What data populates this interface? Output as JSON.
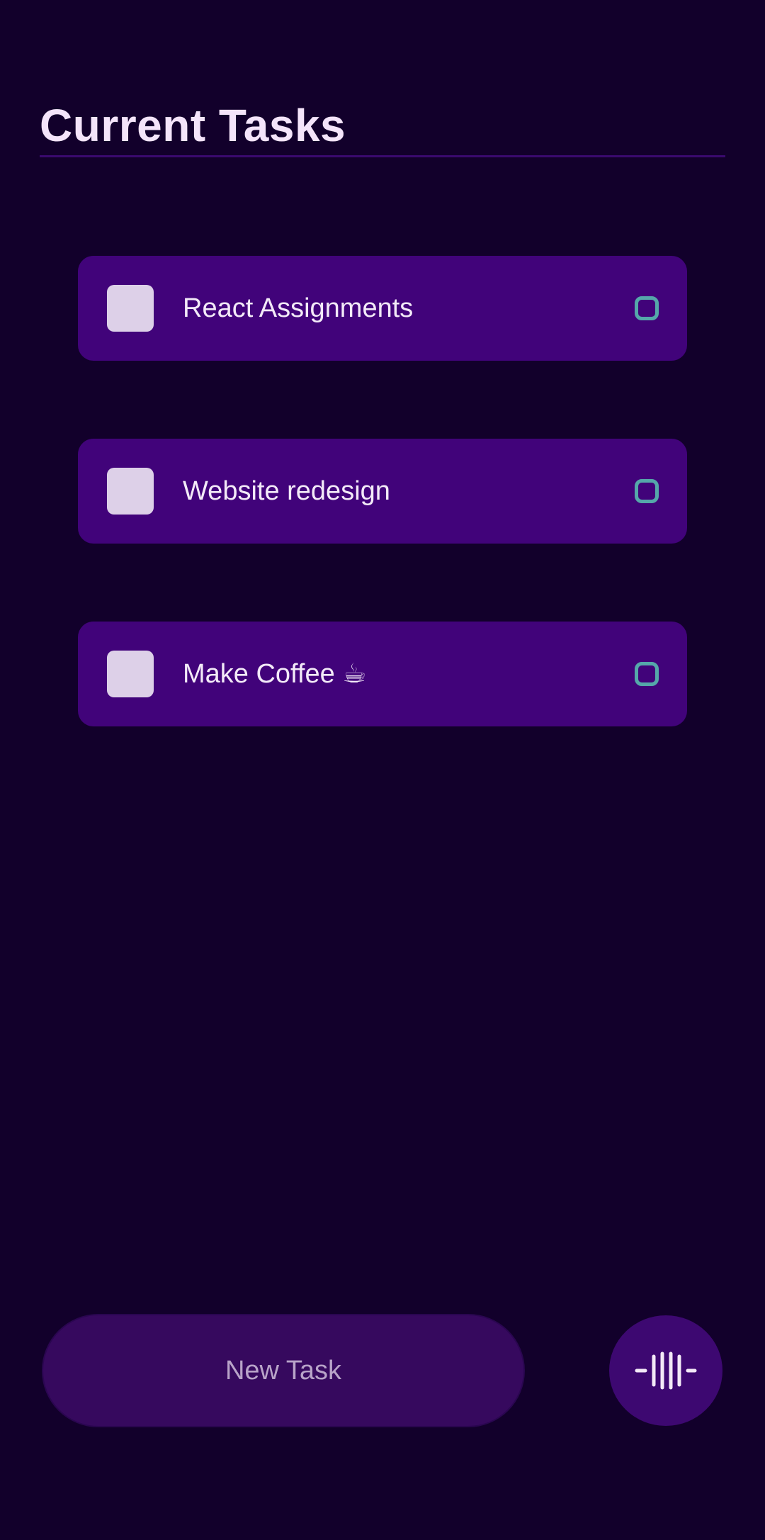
{
  "header": {
    "title": "Current Tasks"
  },
  "tasks": [
    {
      "label": "React Assignments",
      "checked": false
    },
    {
      "label": "Website redesign",
      "checked": false
    },
    {
      "label": "Make Coffee ☕",
      "checked": false
    }
  ],
  "input": {
    "placeholder": "New Task"
  },
  "voice_button": {
    "icon": "voice-waveform-icon"
  },
  "colors": {
    "background": "#12002b",
    "card": "#41037a",
    "status_ring": "#55a7aa",
    "checkbox": "#ddd0e8"
  }
}
